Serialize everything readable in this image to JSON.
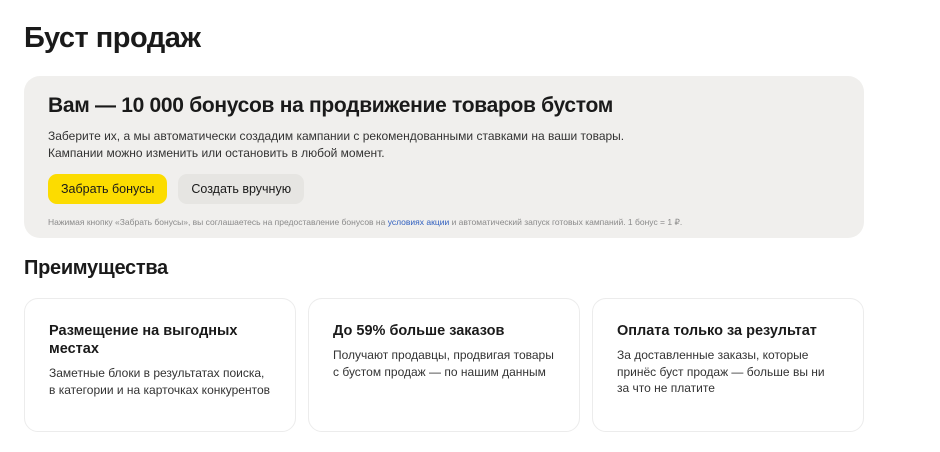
{
  "page": {
    "title": "Буст продаж"
  },
  "promo": {
    "title": "Вам — 10 000 бонусов на продвижение товаров бустом",
    "line1": "Заберите их, а мы автоматически создадим кампании с рекомендованными ставками на ваши товары.",
    "line2": "Кампании можно изменить или остановить в любой момент.",
    "primary_button": "Забрать бонусы",
    "secondary_button": "Создать вручную",
    "footnote_before": "Нажимая кнопку «Забрать бонусы», вы соглашаетесь на предоставление бонусов на ",
    "footnote_link": "условиях акции",
    "footnote_after": " и автоматический запуск готовых кампаний. 1 бонус = 1 ₽.",
    "colors": {
      "background": "#f0efed",
      "primary_button": "#fcdc00",
      "link": "#2f5fbf"
    }
  },
  "advantages": {
    "title": "Преимущества",
    "cards": [
      {
        "title": "Размещение на выгодных местах",
        "text": "Заметные блоки в результатах поиска, в категории и на карточках конкурентов"
      },
      {
        "title": "До 59% больше заказов",
        "text": "Получают продавцы, продвигая товары с бустом продаж — по нашим данным"
      },
      {
        "title": "Оплата только за результат",
        "text": "За доставленные заказы, которые принёс буст продаж — больше вы ни за что не платите"
      }
    ]
  }
}
